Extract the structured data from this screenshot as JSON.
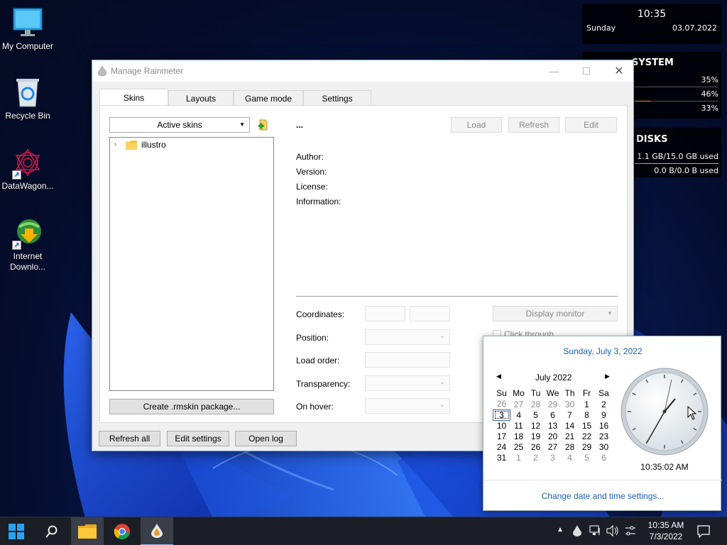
{
  "desktop": {
    "icons": [
      {
        "label": "My Computer",
        "icon": "monitor-icon"
      },
      {
        "label": "Recycle Bin",
        "icon": "recycle-bin-icon"
      },
      {
        "label": "DataWagon...",
        "icon": "datawagon-icon"
      },
      {
        "label": "Internet Downlo...",
        "icon": "internet-download-manager-icon"
      }
    ]
  },
  "widgets": {
    "clock": {
      "time": "10:35",
      "day": "Sunday",
      "date": "03.07.2022"
    },
    "system": {
      "title": "SYSTEM",
      "values": [
        "35%",
        "46%",
        "33%"
      ]
    },
    "disks": {
      "title": "DISKS",
      "rows": [
        "1.1 GB/15.0 GB used",
        "0.0 B/0.0 B used"
      ]
    }
  },
  "window": {
    "title": "Manage Rainmeter",
    "tabs": [
      "Skins",
      "Layouts",
      "Game mode",
      "Settings"
    ],
    "active_skins_label": "Active skins",
    "tree_item": "illustro",
    "skin_name": "...",
    "buttons": {
      "load": "Load",
      "refresh": "Refresh",
      "edit": "Edit"
    },
    "info_labels": {
      "author": "Author:",
      "version": "Version:",
      "license": "License:",
      "information": "Information:"
    },
    "settings_labels": {
      "coordinates": "Coordinates:",
      "position": "Position:",
      "load_order": "Load order:",
      "transparency": "Transparency:",
      "on_hover": "On hover:"
    },
    "display_monitor": "Display monitor",
    "click_through": "Click through",
    "create_package": "Create .rmskin package...",
    "bottom_buttons": {
      "refresh_all": "Refresh all",
      "edit_settings": "Edit settings",
      "open_log": "Open log"
    }
  },
  "flyout": {
    "long_date": "Sunday, July 3, 2022",
    "month_label": "July 2022",
    "weekdays": [
      "Su",
      "Mo",
      "Tu",
      "We",
      "Th",
      "Fr",
      "Sa"
    ],
    "weeks": [
      [
        {
          "d": "26",
          "o": true
        },
        {
          "d": "27",
          "o": true
        },
        {
          "d": "28",
          "o": true
        },
        {
          "d": "29",
          "o": true
        },
        {
          "d": "30",
          "o": true
        },
        {
          "d": "1"
        },
        {
          "d": "2"
        }
      ],
      [
        {
          "d": "3",
          "t": true
        },
        {
          "d": "4"
        },
        {
          "d": "5"
        },
        {
          "d": "6"
        },
        {
          "d": "7"
        },
        {
          "d": "8"
        },
        {
          "d": "9"
        }
      ],
      [
        {
          "d": "10"
        },
        {
          "d": "11"
        },
        {
          "d": "12"
        },
        {
          "d": "13"
        },
        {
          "d": "14"
        },
        {
          "d": "15"
        },
        {
          "d": "16"
        }
      ],
      [
        {
          "d": "17"
        },
        {
          "d": "18"
        },
        {
          "d": "19"
        },
        {
          "d": "20"
        },
        {
          "d": "21"
        },
        {
          "d": "22"
        },
        {
          "d": "23"
        }
      ],
      [
        {
          "d": "24"
        },
        {
          "d": "25"
        },
        {
          "d": "26"
        },
        {
          "d": "27"
        },
        {
          "d": "28"
        },
        {
          "d": "29"
        },
        {
          "d": "30"
        }
      ],
      [
        {
          "d": "31"
        },
        {
          "d": "1",
          "o": true
        },
        {
          "d": "2",
          "o": true
        },
        {
          "d": "3",
          "o": true
        },
        {
          "d": "4",
          "o": true
        },
        {
          "d": "5",
          "o": true
        },
        {
          "d": "6",
          "o": true
        }
      ]
    ],
    "digital_time": "10:35:02 AM",
    "change_link": "Change date and time settings..."
  },
  "taskbar": {
    "time": "10:35 AM",
    "date": "7/3/2022",
    "icons": [
      "start-icon",
      "search-icon",
      "file-explorer-icon",
      "chrome-icon",
      "rainmeter-icon"
    ]
  },
  "colors": {
    "accent": "#1a5fb4",
    "link": "#1a5fb4",
    "taskbar": "#1b1f25"
  }
}
